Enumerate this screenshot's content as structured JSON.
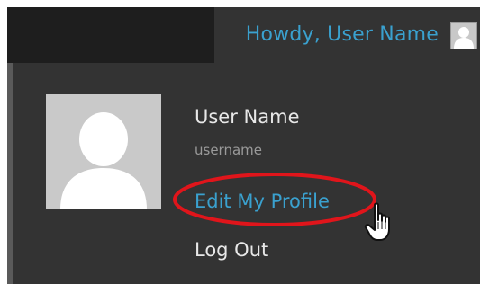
{
  "admin_bar": {
    "greeting": "Howdy, User Name",
    "avatar_icon": "user-avatar-icon"
  },
  "account_menu": {
    "display_name": "User Name",
    "username": "username",
    "edit_profile_label": "Edit My Profile",
    "logout_label": "Log Out",
    "avatar_icon": "user-avatar-icon"
  },
  "annotation": {
    "highlight_color": "#e0151b",
    "cursor_icon": "hand-pointer-icon"
  },
  "colors": {
    "link": "#3aa1cf",
    "menu_bg": "#333333",
    "bar_bg": "#1e1e1e"
  }
}
